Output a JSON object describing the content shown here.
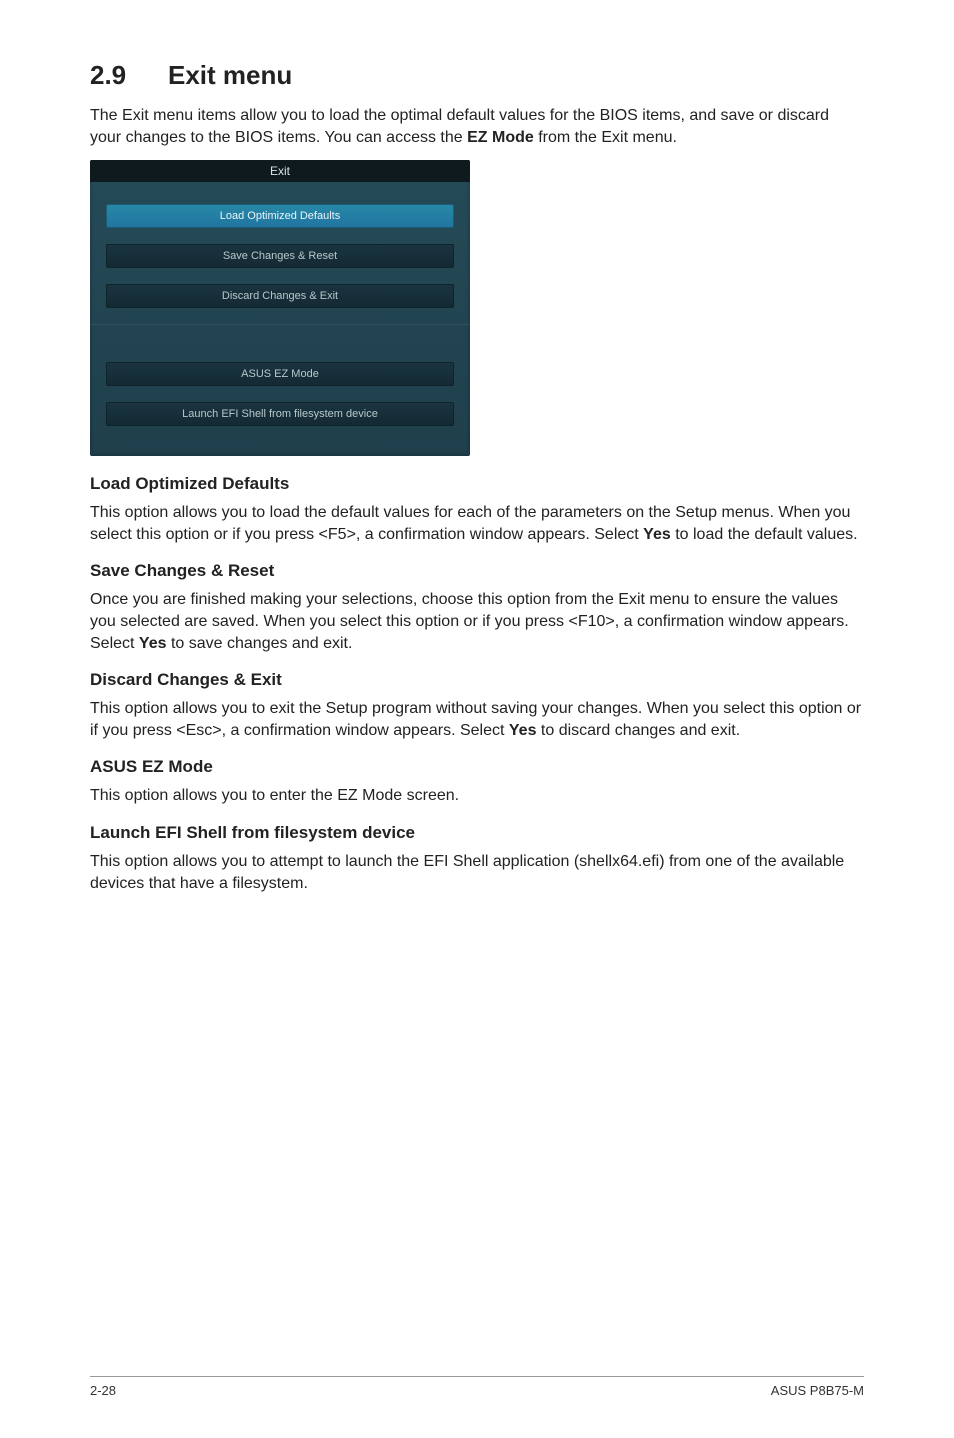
{
  "heading": {
    "number": "2.9",
    "title": "Exit menu"
  },
  "intro": {
    "part1": "The Exit menu items allow you to load the optimal default values for the BIOS items, and save or discard your changes to the BIOS items. You can access the ",
    "bold": "EZ Mode",
    "part2": " from the Exit menu."
  },
  "bios": {
    "title": "Exit",
    "items": [
      {
        "label": "Load Optimized Defaults",
        "highlighted": true
      },
      {
        "label": "Save Changes & Reset",
        "highlighted": false
      },
      {
        "label": "Discard Changes & Exit",
        "highlighted": false
      }
    ],
    "items2": [
      {
        "label": "ASUS EZ Mode",
        "highlighted": false
      },
      {
        "label": "Launch EFI Shell from filesystem device",
        "highlighted": false
      }
    ]
  },
  "sections": {
    "loadDefaults": {
      "title": "Load Optimized Defaults",
      "p1": "This option allows you to load the default values for each of the parameters on the Setup menus. When you select this option or if you press <F5>, a confirmation window appears. Select ",
      "bold": "Yes",
      "p2": " to load the default values."
    },
    "saveReset": {
      "title": "Save Changes & Reset",
      "p1": "Once you are finished making your selections, choose this option from the Exit menu to ensure the values you selected are saved. When you select this option or if you press <F10>, a confirmation window appears. Select ",
      "bold": "Yes",
      "p2": " to save changes and exit."
    },
    "discard": {
      "title": "Discard Changes & Exit",
      "p1": "This option allows you to exit the Setup program without saving your changes. When you select this option or if you press <Esc>, a confirmation window appears. Select ",
      "bold": "Yes",
      "p2": " to discard changes and exit."
    },
    "ezMode": {
      "title": "ASUS EZ Mode",
      "p": "This option allows you to enter the EZ Mode screen."
    },
    "efiShell": {
      "title": "Launch EFI Shell from filesystem device",
      "p": "This option allows you to attempt to launch the EFI Shell application (shellx64.efi) from one of the available devices that have a filesystem."
    }
  },
  "footer": {
    "left": "2-28",
    "right": "ASUS P8B75-M"
  }
}
